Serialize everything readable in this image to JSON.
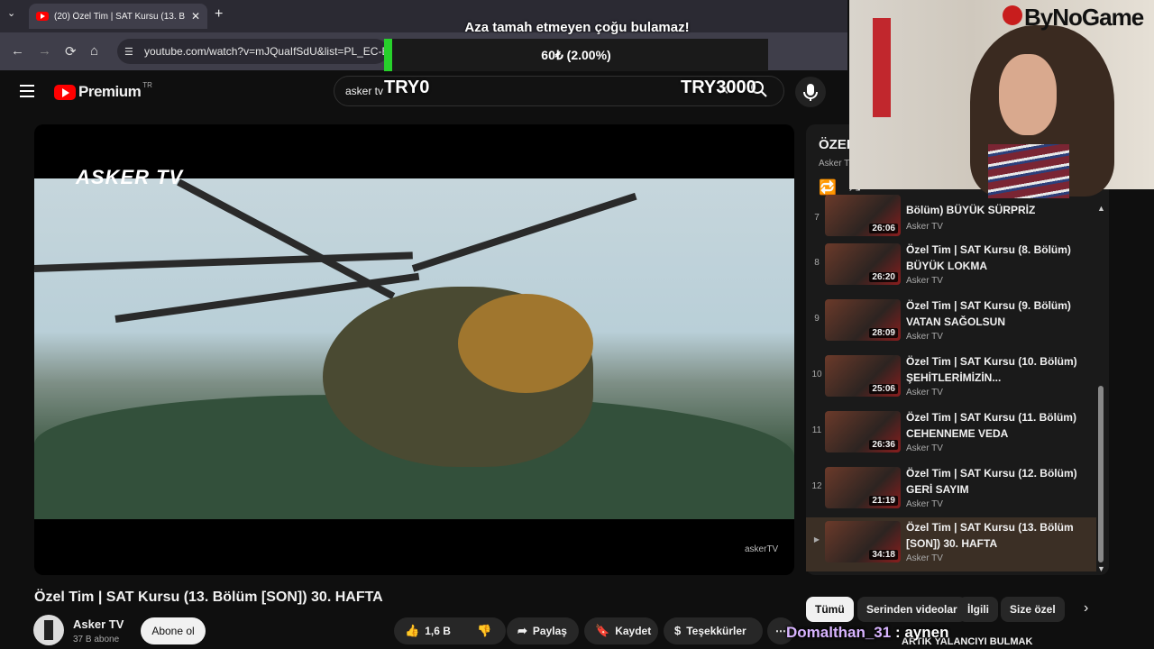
{
  "browser": {
    "tab_title": "(20) Özel Tim | SAT Kursu (13. B",
    "tab_close": "✕",
    "new_tab": "+",
    "url": "youtube.com/watch?v=mJQuaIfSdU&list=PL_EC-Ee",
    "back": "←",
    "forward": "→",
    "reload": "⟳",
    "home": "⌂"
  },
  "donation": {
    "title": "Aza tamah etmeyen çoğu bulamaz!",
    "progress_text": "60₺ (2.00%)",
    "progress_percent": 2.0,
    "min_label": "TRY0",
    "max_label": "TRY3000"
  },
  "youtube": {
    "logo_text": "Premium",
    "country": "TR",
    "search_value": "asker tv",
    "search_clear": "✕"
  },
  "video": {
    "watermark_top": "ASKER TV",
    "watermark_bottom": "askerTV",
    "title": "Özel Tim | SAT Kursu (13. Bölüm [SON]) 30. HAFTA",
    "channel": "Asker TV",
    "subscribers": "37 B abone",
    "subscribe_label": "Abone ol",
    "likes": "1,6 B",
    "share_label": "Paylaş",
    "save_label": "Kaydet",
    "thanks_label": "Teşekkürler",
    "more_label": "⋯"
  },
  "playlist": {
    "title": "ÖZEL",
    "subtitle": "Asker T",
    "items": [
      {
        "index": "7",
        "title": "Bölüm) BÜYÜK SÜRPRİZ",
        "channel": "Asker TV",
        "duration": "26:06"
      },
      {
        "index": "8",
        "title": "Özel Tim | SAT Kursu (8. Bölüm) BÜYÜK LOKMA",
        "channel": "Asker TV",
        "duration": "26:20"
      },
      {
        "index": "9",
        "title": "Özel Tim | SAT Kursu (9. Bölüm) VATAN SAĞOLSUN",
        "channel": "Asker TV",
        "duration": "28:09"
      },
      {
        "index": "10",
        "title": "Özel Tim | SAT Kursu (10. Bölüm) ŞEHİTLERİMİZİN...",
        "channel": "Asker TV",
        "duration": "25:06"
      },
      {
        "index": "11",
        "title": "Özel Tim | SAT Kursu (11. Bölüm) CEHENNEME VEDA",
        "channel": "Asker TV",
        "duration": "26:36"
      },
      {
        "index": "12",
        "title": "Özel Tim | SAT Kursu (12. Bölüm) GERİ SAYIM",
        "channel": "Asker TV",
        "duration": "21:19"
      },
      {
        "index": "▶",
        "title": "Özel Tim | SAT Kursu (13. Bölüm [SON]) 30. HAFTA",
        "channel": "Asker TV",
        "duration": "34:18"
      }
    ]
  },
  "chips": [
    "Tümü",
    "Serinden videolar",
    "İlgili",
    "Size özel"
  ],
  "next_video_partial": "ARTIK YALANCIYI BULMAK",
  "overlay": {
    "brand": "ByNoGame",
    "chat_user": "Domalthan_31",
    "chat_message": ": aynen"
  }
}
